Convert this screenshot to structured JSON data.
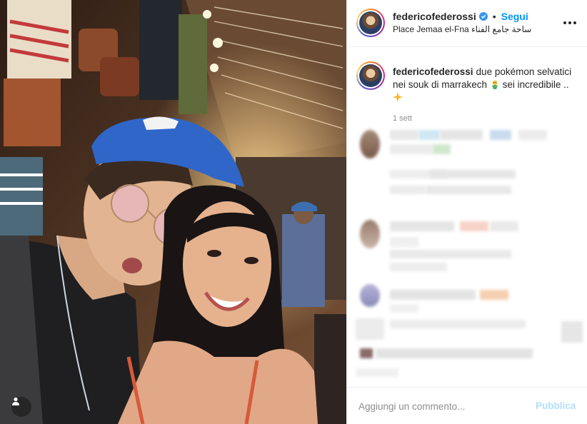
{
  "post": {
    "username": "federicofederossi",
    "follow_label": "Segui",
    "separator": "•",
    "location": "Place Jemaa el-Fna ساحة جامع الفناء",
    "more_icon": "more-horizontal-icon",
    "verified_icon": "verified-badge-icon",
    "photo_alt": "Selfie of a man in a blue cap and round glasses with a smiling woman in a Marrakech souk"
  },
  "caption": {
    "username": "federicofederossi",
    "text": "due pokémon selvatici nei souk di marrakech",
    "text_2": "sei incredibile ..",
    "emoji_1": "genie-emoji",
    "emoji_2": "sparkle-emoji",
    "time": "1 sett"
  },
  "comment_box": {
    "placeholder": "Aggiungi un commento...",
    "publish_label": "Pubblica"
  },
  "colors": {
    "accent": "#0095f6",
    "publish_disabled": "#b2dffc",
    "text": "#262626",
    "muted": "#8e8e8e",
    "border": "#efefef"
  }
}
